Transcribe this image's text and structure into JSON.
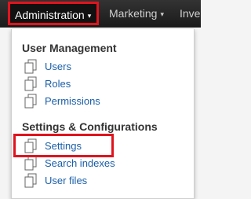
{
  "navbar": {
    "items": [
      {
        "label": "Administration",
        "caret": "▾"
      },
      {
        "label": "Marketing",
        "caret": "▾"
      },
      {
        "label": "Inve"
      }
    ]
  },
  "dropdown": {
    "sections": [
      {
        "title": "User Management",
        "links": [
          {
            "label": "Users",
            "icon": "document-icon"
          },
          {
            "label": "Roles",
            "icon": "document-icon"
          },
          {
            "label": "Permissions",
            "icon": "document-icon"
          }
        ]
      },
      {
        "title": "Settings & Configurations",
        "links": [
          {
            "label": "Settings",
            "icon": "document-icon"
          },
          {
            "label": "Search indexes",
            "icon": "document-icon"
          },
          {
            "label": "User files",
            "icon": "document-icon"
          }
        ]
      }
    ]
  },
  "colors": {
    "highlight": "#e0141e",
    "link": "#1a5fa8",
    "navbar": "#222222"
  }
}
